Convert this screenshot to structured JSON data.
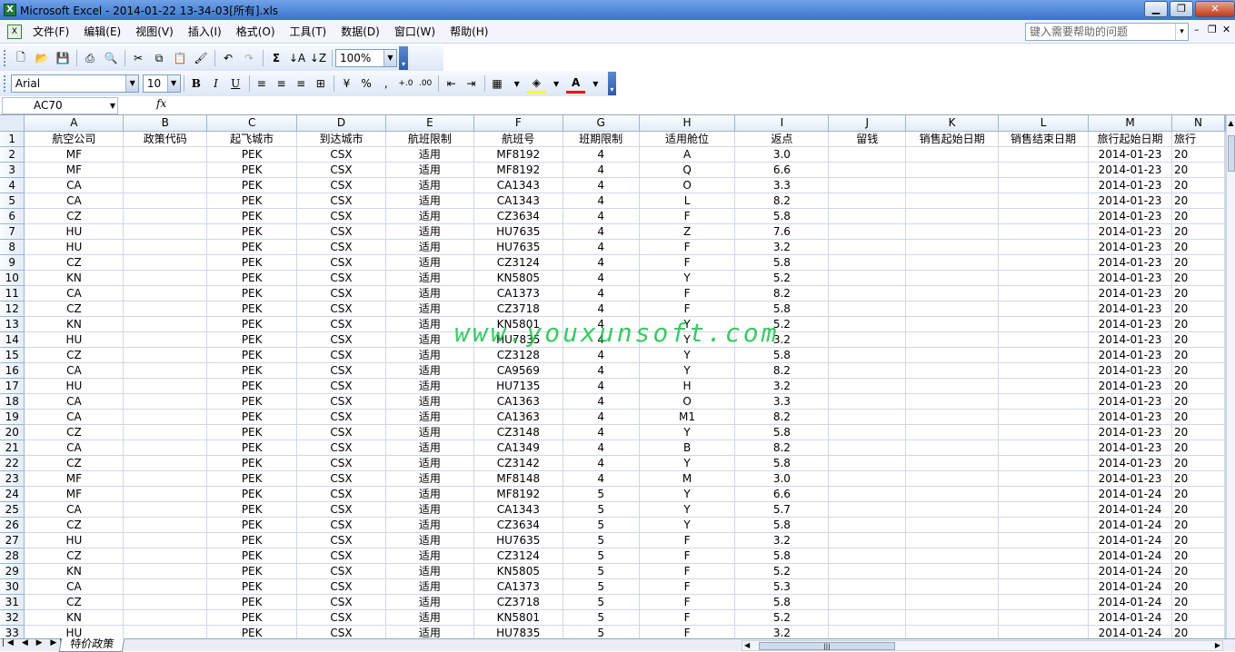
{
  "window": {
    "title": "Microsoft Excel - 2014-01-22 13-34-03[所有].xls",
    "app_icon": "excel-icon",
    "buttons": [
      "▁",
      "❐",
      "✕"
    ]
  },
  "menu": {
    "items": [
      "文件(F)",
      "编辑(E)",
      "视图(V)",
      "插入(I)",
      "格式(O)",
      "工具(T)",
      "数据(D)",
      "窗口(W)",
      "帮助(H)"
    ],
    "help_placeholder": "键入需要帮助的问题",
    "mdi_buttons": [
      "▾",
      "–",
      "❐",
      "✕"
    ]
  },
  "toolbar": {
    "zoom": "100%",
    "font_name": "Arial",
    "font_size": "10",
    "bold": "B",
    "italic": "I",
    "underline": "U",
    "percent": "%",
    "comma": ",",
    "inc_decimal": "+.0",
    "dec_decimal": ".00",
    "sum": "Σ"
  },
  "formula_bar": {
    "name_box": "AC70",
    "fx": "fx",
    "content": ""
  },
  "sheet": {
    "columns": [
      "A",
      "B",
      "C",
      "D",
      "E",
      "F",
      "G",
      "H",
      "I",
      "J",
      "K",
      "L",
      "M",
      "N"
    ],
    "header_row": [
      "航空公司",
      "政策代码",
      "起飞城市",
      "到达城市",
      "航班限制",
      "航班号",
      "班期限制",
      "适用舱位",
      "返点",
      "留钱",
      "销售起始日期",
      "销售结束日期",
      "旅行起始日期",
      "旅行"
    ],
    "rows": [
      [
        "MF",
        "",
        "PEK",
        "CSX",
        "适用",
        "MF8192",
        "4",
        "A",
        "3.0",
        "",
        "",
        "",
        "2014-01-23",
        "20"
      ],
      [
        "MF",
        "",
        "PEK",
        "CSX",
        "适用",
        "MF8192",
        "4",
        "Q",
        "6.6",
        "",
        "",
        "",
        "2014-01-23",
        "20"
      ],
      [
        "CA",
        "",
        "PEK",
        "CSX",
        "适用",
        "CA1343",
        "4",
        "O",
        "3.3",
        "",
        "",
        "",
        "2014-01-23",
        "20"
      ],
      [
        "CA",
        "",
        "PEK",
        "CSX",
        "适用",
        "CA1343",
        "4",
        "L",
        "8.2",
        "",
        "",
        "",
        "2014-01-23",
        "20"
      ],
      [
        "CZ",
        "",
        "PEK",
        "CSX",
        "适用",
        "CZ3634",
        "4",
        "F",
        "5.8",
        "",
        "",
        "",
        "2014-01-23",
        "20"
      ],
      [
        "HU",
        "",
        "PEK",
        "CSX",
        "适用",
        "HU7635",
        "4",
        "Z",
        "7.6",
        "",
        "",
        "",
        "2014-01-23",
        "20"
      ],
      [
        "HU",
        "",
        "PEK",
        "CSX",
        "适用",
        "HU7635",
        "4",
        "F",
        "3.2",
        "",
        "",
        "",
        "2014-01-23",
        "20"
      ],
      [
        "CZ",
        "",
        "PEK",
        "CSX",
        "适用",
        "CZ3124",
        "4",
        "F",
        "5.8",
        "",
        "",
        "",
        "2014-01-23",
        "20"
      ],
      [
        "KN",
        "",
        "PEK",
        "CSX",
        "适用",
        "KN5805",
        "4",
        "Y",
        "5.2",
        "",
        "",
        "",
        "2014-01-23",
        "20"
      ],
      [
        "CA",
        "",
        "PEK",
        "CSX",
        "适用",
        "CA1373",
        "4",
        "F",
        "8.2",
        "",
        "",
        "",
        "2014-01-23",
        "20"
      ],
      [
        "CZ",
        "",
        "PEK",
        "CSX",
        "适用",
        "CZ3718",
        "4",
        "F",
        "5.8",
        "",
        "",
        "",
        "2014-01-23",
        "20"
      ],
      [
        "KN",
        "",
        "PEK",
        "CSX",
        "适用",
        "KN5801",
        "4",
        "Y",
        "5.2",
        "",
        "",
        "",
        "2014-01-23",
        "20"
      ],
      [
        "HU",
        "",
        "PEK",
        "CSX",
        "适用",
        "HU7835",
        "4",
        "Y",
        "3.2",
        "",
        "",
        "",
        "2014-01-23",
        "20"
      ],
      [
        "CZ",
        "",
        "PEK",
        "CSX",
        "适用",
        "CZ3128",
        "4",
        "Y",
        "5.8",
        "",
        "",
        "",
        "2014-01-23",
        "20"
      ],
      [
        "CA",
        "",
        "PEK",
        "CSX",
        "适用",
        "CA9569",
        "4",
        "Y",
        "8.2",
        "",
        "",
        "",
        "2014-01-23",
        "20"
      ],
      [
        "HU",
        "",
        "PEK",
        "CSX",
        "适用",
        "HU7135",
        "4",
        "H",
        "3.2",
        "",
        "",
        "",
        "2014-01-23",
        "20"
      ],
      [
        "CA",
        "",
        "PEK",
        "CSX",
        "适用",
        "CA1363",
        "4",
        "O",
        "3.3",
        "",
        "",
        "",
        "2014-01-23",
        "20"
      ],
      [
        "CA",
        "",
        "PEK",
        "CSX",
        "适用",
        "CA1363",
        "4",
        "M1",
        "8.2",
        "",
        "",
        "",
        "2014-01-23",
        "20"
      ],
      [
        "CZ",
        "",
        "PEK",
        "CSX",
        "适用",
        "CZ3148",
        "4",
        "Y",
        "5.8",
        "",
        "",
        "",
        "2014-01-23",
        "20"
      ],
      [
        "CA",
        "",
        "PEK",
        "CSX",
        "适用",
        "CA1349",
        "4",
        "B",
        "8.2",
        "",
        "",
        "",
        "2014-01-23",
        "20"
      ],
      [
        "CZ",
        "",
        "PEK",
        "CSX",
        "适用",
        "CZ3142",
        "4",
        "Y",
        "5.8",
        "",
        "",
        "",
        "2014-01-23",
        "20"
      ],
      [
        "MF",
        "",
        "PEK",
        "CSX",
        "适用",
        "MF8148",
        "4",
        "M",
        "3.0",
        "",
        "",
        "",
        "2014-01-23",
        "20"
      ],
      [
        "MF",
        "",
        "PEK",
        "CSX",
        "适用",
        "MF8192",
        "5",
        "Y",
        "6.6",
        "",
        "",
        "",
        "2014-01-24",
        "20"
      ],
      [
        "CA",
        "",
        "PEK",
        "CSX",
        "适用",
        "CA1343",
        "5",
        "Y",
        "5.7",
        "",
        "",
        "",
        "2014-01-24",
        "20"
      ],
      [
        "CZ",
        "",
        "PEK",
        "CSX",
        "适用",
        "CZ3634",
        "5",
        "Y",
        "5.8",
        "",
        "",
        "",
        "2014-01-24",
        "20"
      ],
      [
        "HU",
        "",
        "PEK",
        "CSX",
        "适用",
        "HU7635",
        "5",
        "F",
        "3.2",
        "",
        "",
        "",
        "2014-01-24",
        "20"
      ],
      [
        "CZ",
        "",
        "PEK",
        "CSX",
        "适用",
        "CZ3124",
        "5",
        "F",
        "5.8",
        "",
        "",
        "",
        "2014-01-24",
        "20"
      ],
      [
        "KN",
        "",
        "PEK",
        "CSX",
        "适用",
        "KN5805",
        "5",
        "F",
        "5.2",
        "",
        "",
        "",
        "2014-01-24",
        "20"
      ],
      [
        "CA",
        "",
        "PEK",
        "CSX",
        "适用",
        "CA1373",
        "5",
        "F",
        "5.3",
        "",
        "",
        "",
        "2014-01-24",
        "20"
      ],
      [
        "CZ",
        "",
        "PEK",
        "CSX",
        "适用",
        "CZ3718",
        "5",
        "F",
        "5.8",
        "",
        "",
        "",
        "2014-01-24",
        "20"
      ],
      [
        "KN",
        "",
        "PEK",
        "CSX",
        "适用",
        "KN5801",
        "5",
        "F",
        "5.2",
        "",
        "",
        "",
        "2014-01-24",
        "20"
      ],
      [
        "HU",
        "",
        "PEK",
        "CSX",
        "适用",
        "HU7835",
        "5",
        "F",
        "3.2",
        "",
        "",
        "",
        "2014-01-24",
        "20"
      ]
    ]
  },
  "tabs": {
    "nav": "|◀ ◀ ▶ ▶|",
    "sheet_name": "特价政策"
  },
  "watermark": "www.youxunsoft.com"
}
